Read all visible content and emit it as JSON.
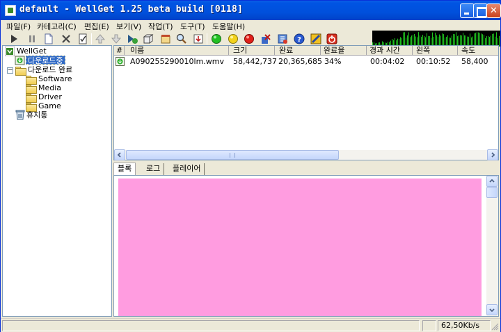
{
  "window": {
    "title": "default - WellGet 1.25 beta  build [0118]"
  },
  "menu": [
    "파일(F)",
    "카테고리(C)",
    "편집(E)",
    "보기(V)",
    "작업(T)",
    "도구(T)",
    "도움말(H)"
  ],
  "toolbar": {
    "icons": [
      "play-icon",
      "pause-icon",
      "new-icon",
      "delete-icon",
      "properties-icon",
      "move-up-icon",
      "move-down-icon",
      "start-all-icon",
      "category-icon",
      "schedule-icon",
      "search-icon",
      "download-icon",
      "green-light-icon",
      "yellow-light-icon",
      "red-light-icon",
      "remove-icon",
      "settings-icon",
      "help-icon",
      "about-icon",
      "exit-icon"
    ]
  },
  "tree": {
    "root": "WellGet",
    "items": [
      {
        "label": "다운로드중",
        "selected": true
      },
      {
        "label": "다운로드 완료"
      },
      {
        "label": "Software"
      },
      {
        "label": "Media"
      },
      {
        "label": "Driver"
      },
      {
        "label": "Game"
      },
      {
        "label": "휴지통"
      }
    ]
  },
  "list": {
    "columns": [
      "#",
      "이름",
      "크기",
      "완료",
      "완료율",
      "경과 시간",
      "왼쪽",
      "속도"
    ],
    "rows": [
      {
        "name": "A090255290010lm.wmv",
        "size": "58,442,737",
        "done": "20,365,685",
        "percent": "34%",
        "elapsed": "00:04:02",
        "left": "00:10:52",
        "speed": "58,400"
      }
    ]
  },
  "tabs": [
    "블록",
    "로그",
    "플레이어"
  ],
  "status": {
    "speed": "62,50Kb/s"
  },
  "colors": {
    "block_fill": "#ff9ce0",
    "graph_line": "#1fc21f",
    "selected": "#316ac5"
  }
}
